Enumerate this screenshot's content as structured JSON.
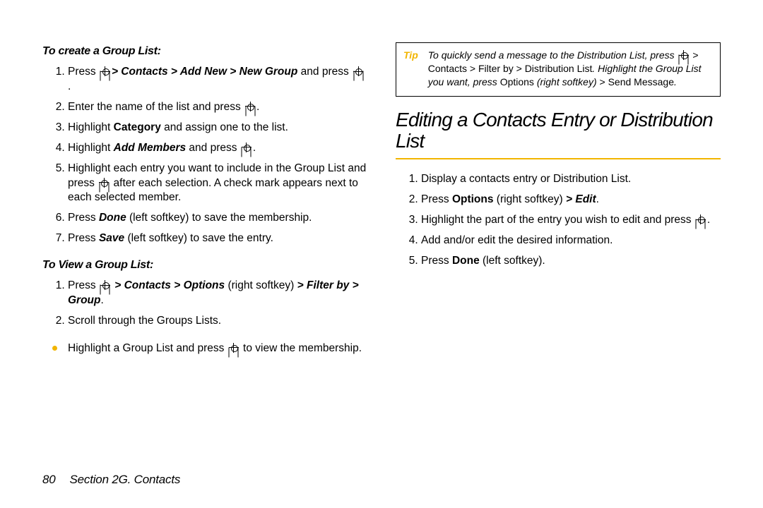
{
  "left": {
    "create_head": "To create a Group List:",
    "steps_create": [
      {
        "pre": "Press ",
        "icon": true,
        "mid": " ",
        "path": "> Contacts > Add New > New Group",
        "post1": " and press ",
        "icon2": true,
        "post2": "."
      },
      {
        "pre": "Enter the name of the list and press ",
        "icon": true,
        "post2": "."
      },
      {
        "pre": "Highlight ",
        "b": "Category",
        "post1": " and assign one to the list."
      },
      {
        "pre": "Highlight ",
        "bi": "Add Members",
        "post1": " and press ",
        "icon": true,
        "post2": "."
      },
      {
        "pre": "Highlight each entry you want to include in the Group List and press ",
        "icon": true,
        "post1": " after each selection. A check mark appears next to each selected member."
      },
      {
        "pre": "Press ",
        "bi": "Done",
        "post1": " (left softkey) to save the membership."
      },
      {
        "pre": "Press ",
        "bi": "Save",
        "post1": " (left softkey) to save the entry."
      }
    ],
    "view_head": "To View a Group List:",
    "steps_view": [
      {
        "pre": "Press ",
        "icon": true,
        "mid": " ",
        "path": "> Contacts > Options",
        "post1": " (right softkey) ",
        "path2": "> Filter by > Group",
        "post2": "."
      },
      {
        "pre": "Scroll through the Groups Lists."
      }
    ],
    "bullet_view": {
      "pre": "Highlight a Group List and press ",
      "icon": true,
      "post1": " to view the membership."
    }
  },
  "right": {
    "tip_label": "Tip",
    "tip_body": {
      "l1": "To quickly send a message to the Distribution List, press ",
      "l1_icon": true,
      "l1b": " > Contacts > Filter by > Distribution List",
      "l2a": ". Highlight the Group List you want, press ",
      "l2b": "Options",
      "l3a": " (right softkey) ",
      "l3b": "> Send Message",
      "l3c": "."
    },
    "section_title": "Editing a Contacts Entry or Distribution List",
    "steps": [
      {
        "pre": "Display a contacts entry or Distribution List."
      },
      {
        "pre": "Press ",
        "b": "Options",
        "post1": " (right softkey) ",
        "bi": "> Edit",
        "post2": "."
      },
      {
        "pre": "Highlight the part of the entry you wish to edit and press ",
        "icon": true,
        "post2": "."
      },
      {
        "pre": "Add and/or edit the desired information."
      },
      {
        "pre": "Press ",
        "b": "Done",
        "post1": " (left softkey)."
      }
    ]
  },
  "footer": {
    "page": "80",
    "section": "Section 2G. Contacts"
  }
}
